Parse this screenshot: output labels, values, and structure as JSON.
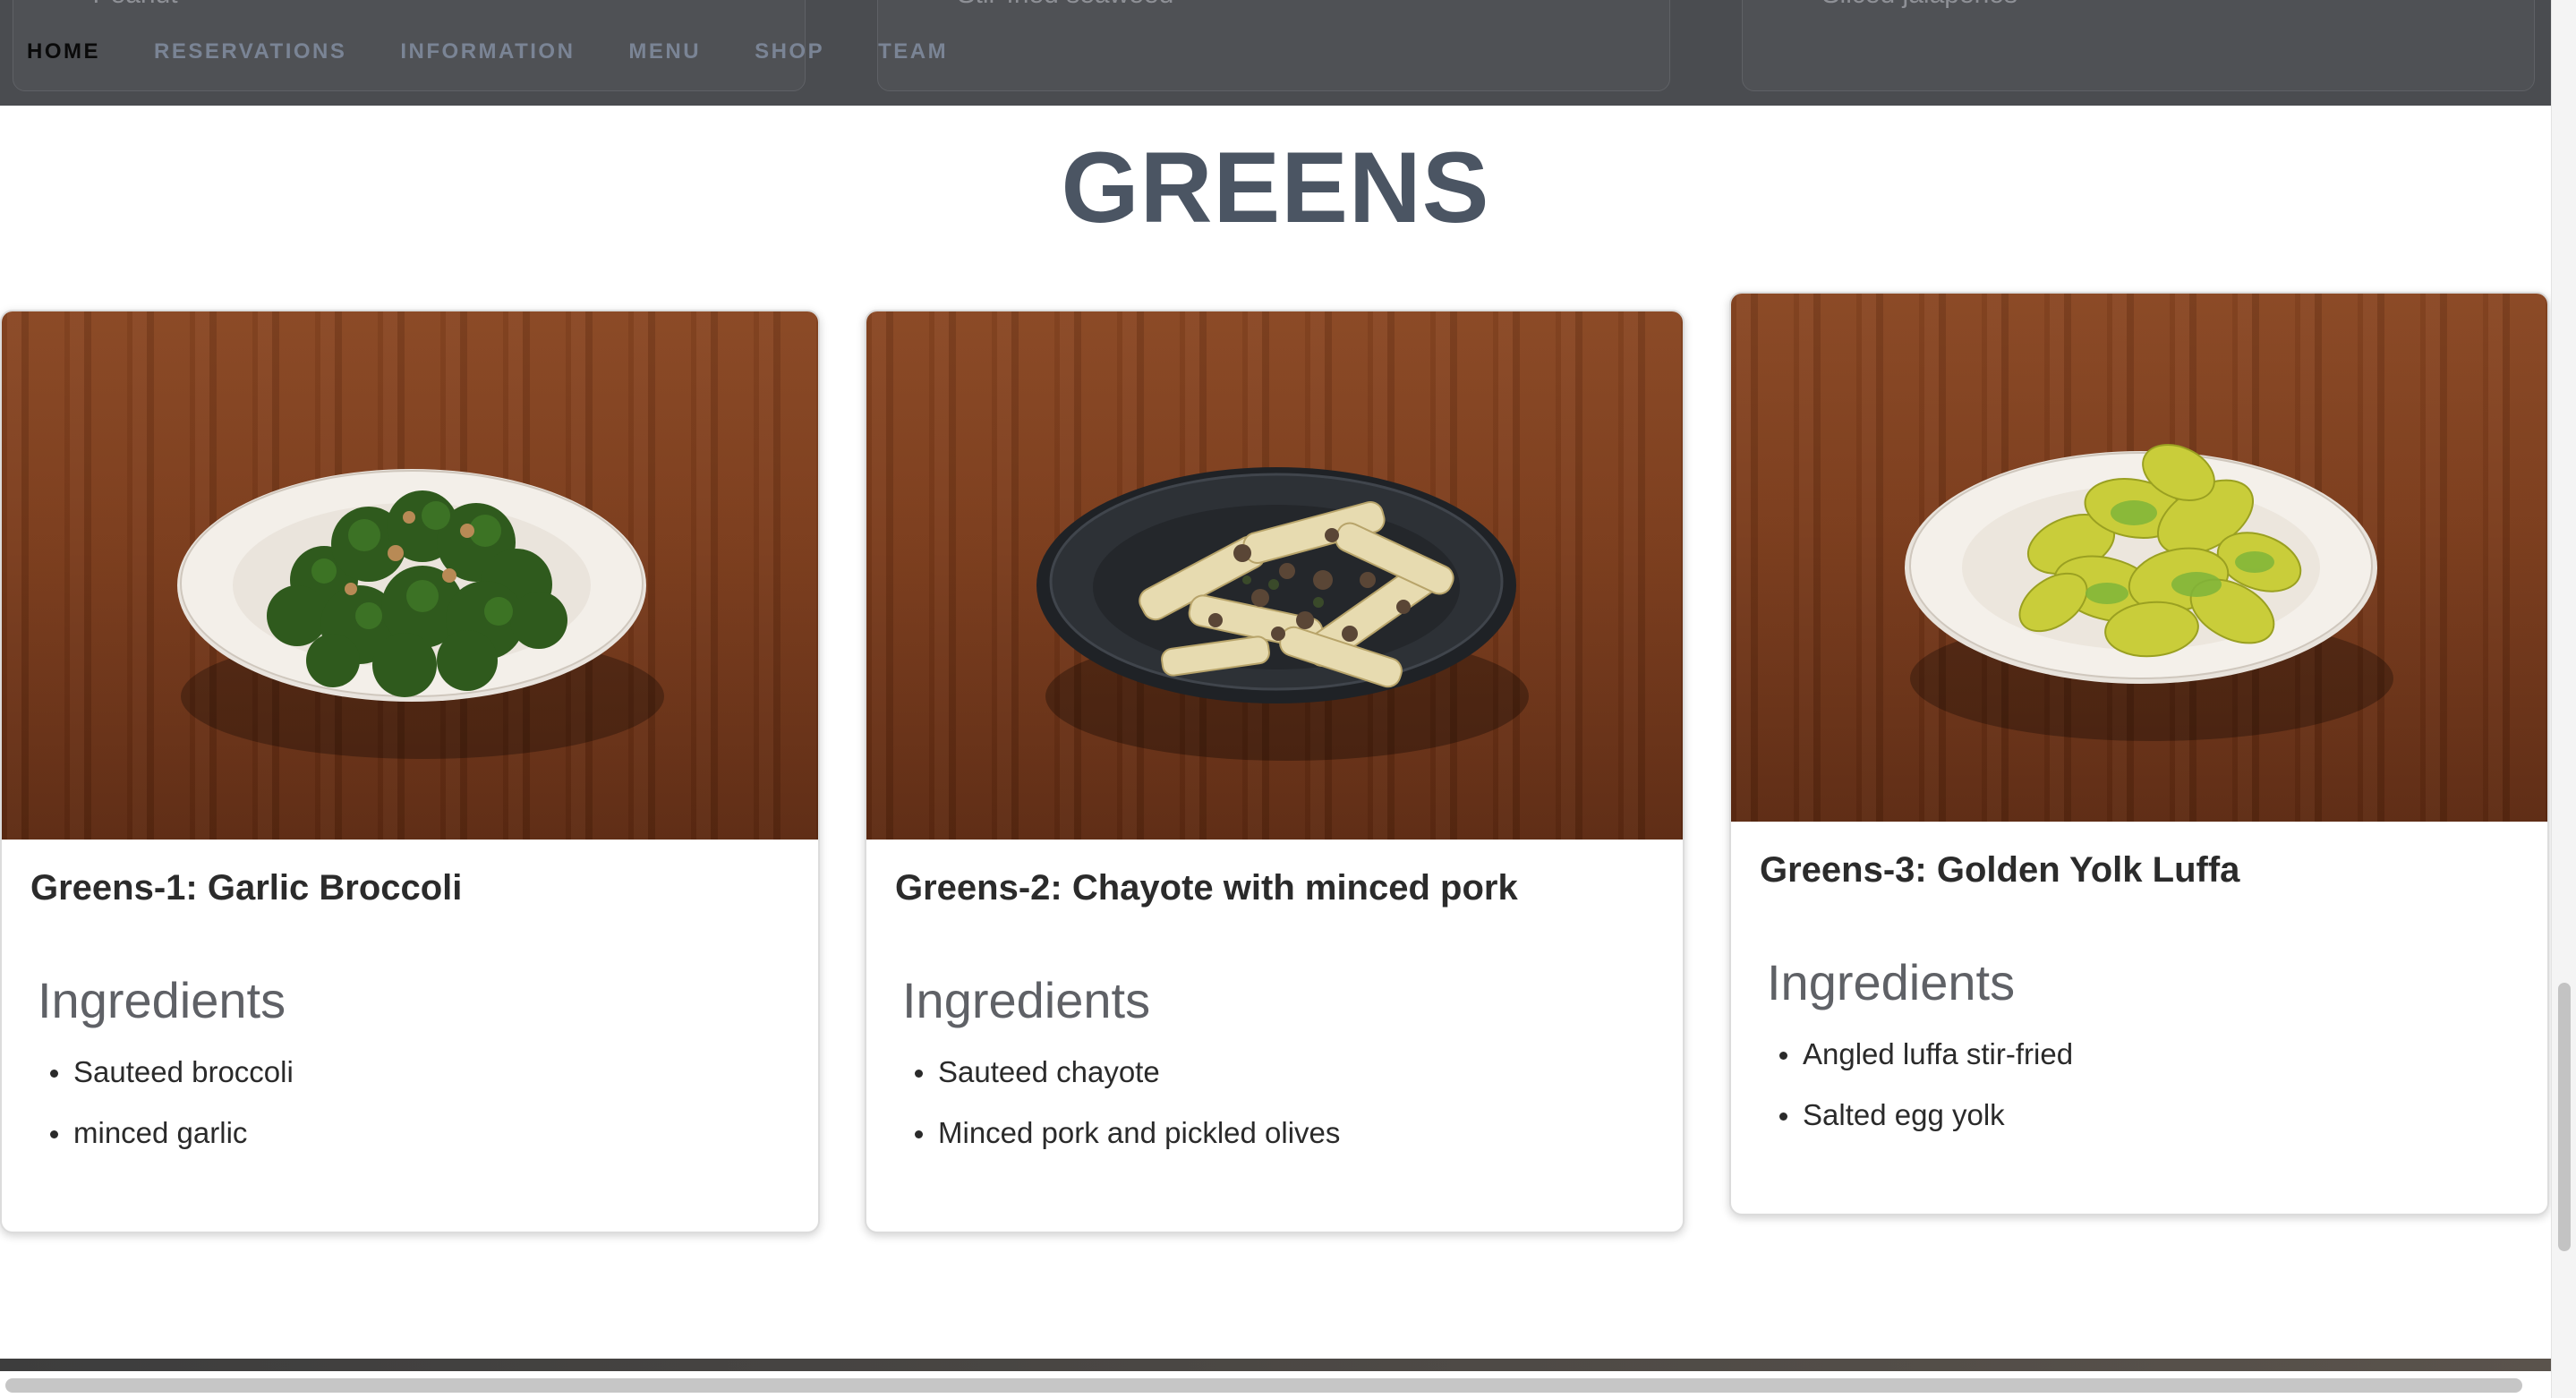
{
  "nav": {
    "items": [
      {
        "label": "HOME",
        "active": true
      },
      {
        "label": "RESERVATIONS",
        "active": false
      },
      {
        "label": "INFORMATION",
        "active": false
      },
      {
        "label": "MENU",
        "active": false
      },
      {
        "label": "SHOP",
        "active": false
      },
      {
        "label": "TEAM",
        "active": false
      }
    ]
  },
  "previous_section": {
    "visible_bullets": [
      "Peanut",
      "Stir-fried seaweed",
      "Sliced jalapenos"
    ]
  },
  "section": {
    "title": "GREENS"
  },
  "dishes": [
    {
      "title": "Greens-1: Garlic Broccoli",
      "ingredients_heading": "Ingredients",
      "ingredients": [
        "Sauteed broccoli",
        "minced garlic"
      ],
      "image_icon": "broccoli-plate"
    },
    {
      "title": "Greens-2: Chayote with minced pork",
      "ingredients_heading": "Ingredients",
      "ingredients": [
        "Sauteed chayote",
        "Minced pork and pickled olives"
      ],
      "image_icon": "chayote-plate"
    },
    {
      "title": "Greens-3: Golden Yolk Luffa",
      "ingredients_heading": "Ingredients",
      "ingredients": [
        "Angled luffa stir-fried",
        "Salted egg yolk"
      ],
      "image_icon": "luffa-plate"
    }
  ],
  "colors": {
    "nav_bg": "#4a4c50",
    "nav_active": "#0a0a0a",
    "nav_inactive": "#7a8495",
    "title": "#4b5563",
    "wood": "#7a3b1b"
  }
}
